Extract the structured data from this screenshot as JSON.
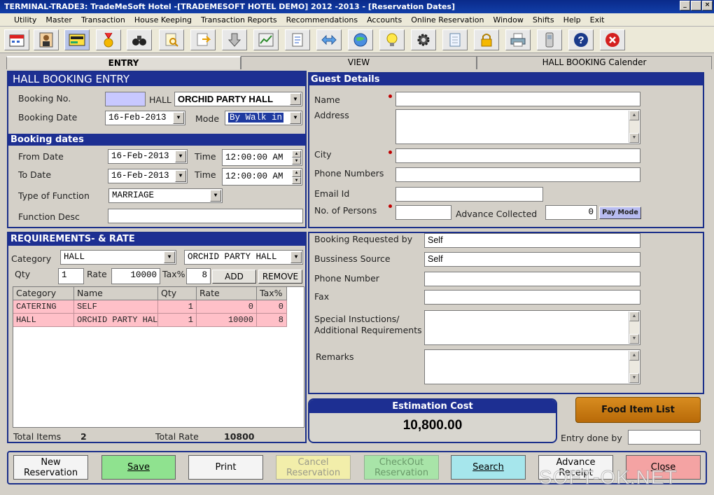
{
  "window": {
    "title": "TERMINAL-TRADE3: TradeMeSoft Hotel -[TRADEMESOFT HOTEL DEMO] 2012 -2013 - [Reservation Dates]",
    "controls": [
      "_",
      " ",
      "×"
    ]
  },
  "menu": [
    "Utility",
    "Master",
    "Transaction",
    "House Keeping",
    "Transaction Reports",
    "Recommendations",
    "Accounts",
    "Online Reservation",
    "Window",
    "Shifts",
    "Help",
    "Exit"
  ],
  "toolbar_icons": [
    "calendar-icon",
    "person-icon",
    "card-icon",
    "medal-icon",
    "binoculars-icon",
    "search-doc-icon",
    "export-doc-icon",
    "download-arrow-icon",
    "chart-icon",
    "document-icon",
    "transfer-icon",
    "globe-icon",
    "lightbulb-icon",
    "gear-icon",
    "notepad-icon",
    "lock-icon",
    "printer-icon",
    "phone-icon",
    "help-icon",
    "close-icon"
  ],
  "tabs": [
    "ENTRY",
    "VIEW",
    "HALL BOOKING Calender"
  ],
  "booking": {
    "title": "HALL BOOKING ENTRY",
    "booking_no_label": "Booking No.",
    "booking_no": "",
    "hall_label": "HALL",
    "hall_value": "ORCHID PARTY HALL",
    "booking_date_label": "Booking Date",
    "booking_date": "16-Feb-2013",
    "mode_label": "Mode",
    "mode_value": "By Walk in"
  },
  "dates": {
    "title": "Booking  dates",
    "from_label": "From Date",
    "from_date": "16-Feb-2013",
    "to_label": "To Date",
    "to_date": "16-Feb-2013",
    "time_label": "Time",
    "from_time": "12:00:00 AM",
    "to_time": "12:00:00 AM",
    "function_type_label": "Type of Function",
    "function_type": "MARRIAGE",
    "function_desc_label": "Function Desc",
    "function_desc": ""
  },
  "requirements": {
    "title": "REQUIREMENTS- & RATE",
    "category_label": "Category",
    "category": "HALL",
    "item": "ORCHID PARTY HALL",
    "qty_label": "Qty",
    "qty": "1",
    "rate_label": "Rate",
    "rate": "10000",
    "tax_label": "Tax%",
    "tax": "8",
    "add_label": "ADD",
    "remove_label": "REMOVE",
    "columns": [
      "Category",
      "Name",
      "Qty",
      "Rate",
      "Tax%"
    ],
    "rows": [
      [
        "CATERING",
        "SELF",
        "1",
        "0",
        "0"
      ],
      [
        "HALL",
        "ORCHID PARTY HALL",
        "1",
        "10000",
        "8"
      ]
    ],
    "total_items_label": "Total  Items",
    "total_items": "2",
    "total_rate_label": "Total Rate",
    "total_rate": "10800"
  },
  "guest": {
    "title": "Guest Details",
    "name_label": "Name",
    "name": "",
    "address_label": "Address",
    "address": "",
    "city_label": "City",
    "city": "",
    "phone_label": "Phone Numbers",
    "phone": "",
    "email_label": "Email Id",
    "email": "",
    "persons_label": "No. of Persons",
    "persons": "",
    "advance_label": "Advance Collected",
    "advance": "0",
    "paymode_label": "Pay Mode"
  },
  "extra": {
    "requested_by_label": "Booking Requested by",
    "requested_by": "Self",
    "source_label": "Bussiness Source",
    "source": "Self",
    "phone_label": "Phone Number",
    "phone": "",
    "fax_label": "Fax",
    "fax": "",
    "special_label_1": "Special Instuctions/",
    "special_label_2": "Additional Requirements",
    "special": "",
    "remarks_label": "Remarks",
    "remarks": ""
  },
  "estimation": {
    "title": "Estimation Cost",
    "value": "10,800.00"
  },
  "food_item_label": "Food Item List",
  "entry_done_label": "Entry done by",
  "entry_done": "",
  "buttons": {
    "new_1": "New",
    "new_2": "Reservation",
    "save": "Save",
    "print": "Print",
    "cancel_1": "Cancel",
    "cancel_2": "Reservation",
    "checkout_1": "CheckOut",
    "checkout_2": "Reservation",
    "search": "Search",
    "advance_1": "Advance",
    "advance_2": "Receipt",
    "close": "Close"
  },
  "watermark": "SOFT-OK.NET",
  "colors": {
    "header_blue": "#1d2f92",
    "grid_row_pink": "#ffc0c8",
    "save_green": "#8fe28f",
    "search_cyan": "#a6e6ec",
    "close_red": "#f4a3a3",
    "food_orange": "#c77b12"
  }
}
